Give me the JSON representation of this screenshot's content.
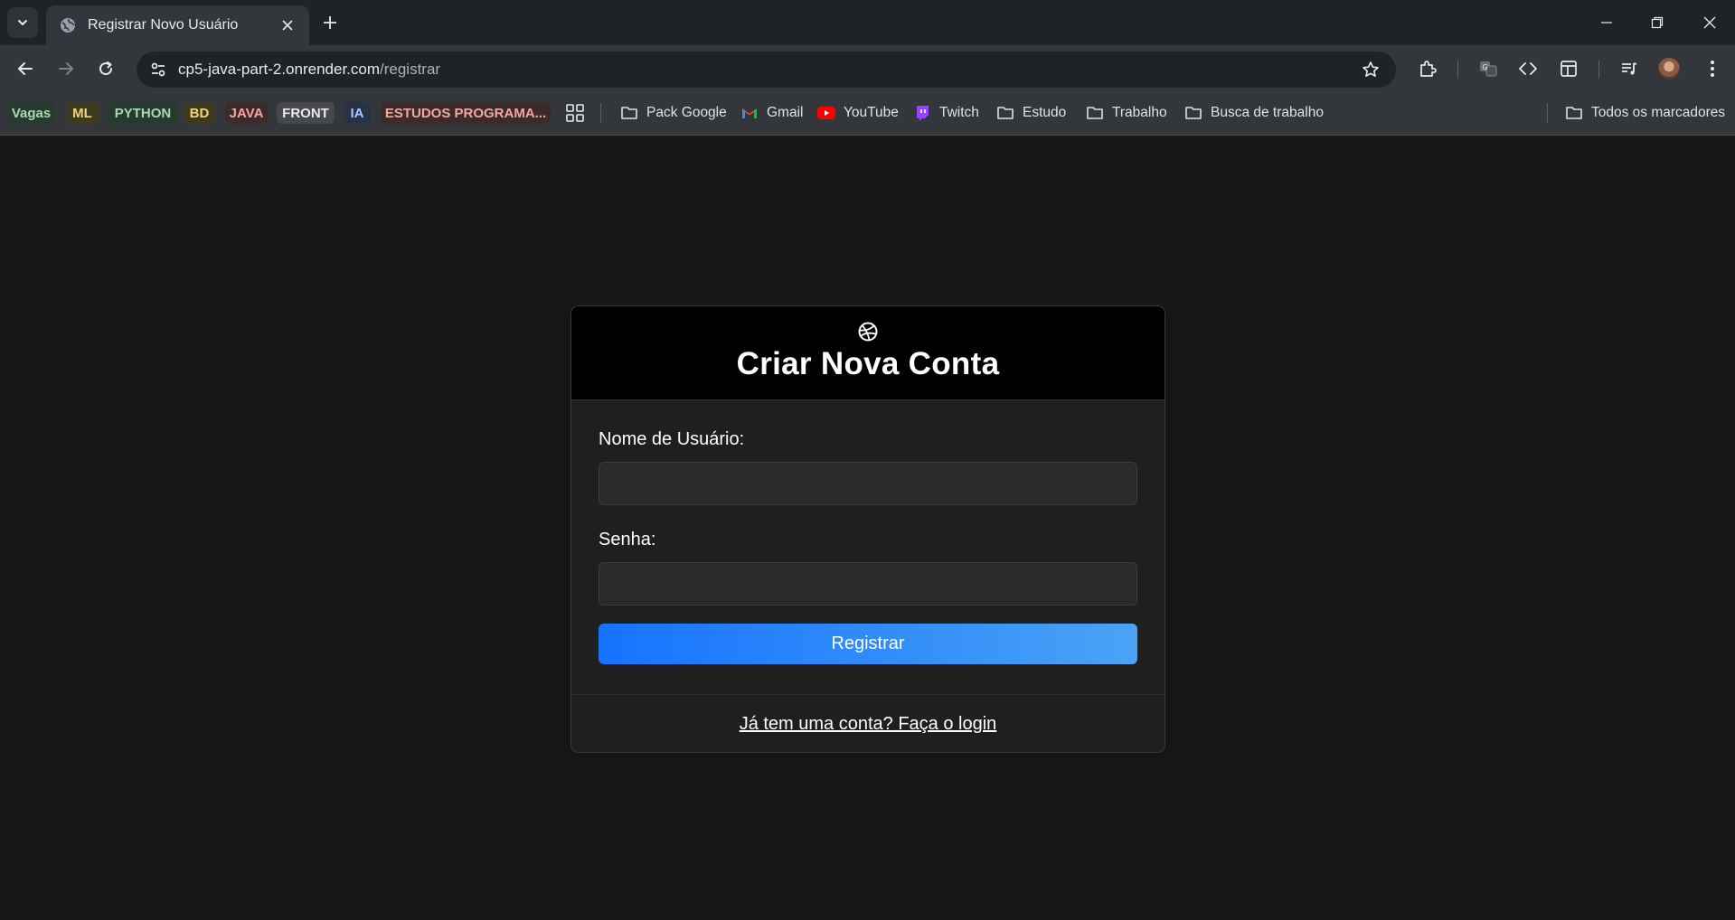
{
  "browser": {
    "tab": {
      "title": "Registrar Novo Usuário"
    },
    "address": {
      "host": "cp5-java-part-2.onrender.com",
      "path": "/registrar"
    },
    "bookmark_chips": [
      {
        "label": "Vagas",
        "bg": "#263a2e",
        "fg": "#a8dab5"
      },
      {
        "label": "ML",
        "bg": "#3e3a1e",
        "fg": "#f5d37a"
      },
      {
        "label": "PYTHON",
        "bg": "#263a2e",
        "fg": "#a8dab5"
      },
      {
        "label": "BD",
        "bg": "#3e3a1e",
        "fg": "#f5d37a"
      },
      {
        "label": "JAVA",
        "bg": "#3d2a2a",
        "fg": "#f2a8a0"
      },
      {
        "label": "FRONT",
        "bg": "#46484c",
        "fg": "#e8eaed"
      },
      {
        "label": "IA",
        "bg": "#283246",
        "fg": "#a8c7fa"
      },
      {
        "label": "ESTUDOS PROGRAMA...",
        "bg": "#3d2a2a",
        "fg": "#f2a8a0"
      }
    ],
    "bookmarks": [
      {
        "label": "Pack Google",
        "icon": "folder-icon"
      },
      {
        "label": "Gmail",
        "icon": "gmail-icon"
      },
      {
        "label": "YouTube",
        "icon": "youtube-icon"
      },
      {
        "label": "Twitch",
        "icon": "twitch-icon"
      },
      {
        "label": "Estudo",
        "icon": "folder-icon"
      },
      {
        "label": "Trabalho",
        "icon": "folder-icon"
      },
      {
        "label": "Busca de trabalho",
        "icon": "folder-icon"
      }
    ],
    "all_bookmarks_label": "Todos os marcadores"
  },
  "form": {
    "logo_icon": "dribbble-ball-icon",
    "title": "Criar Nova Conta",
    "username_label": "Nome de Usuário:",
    "username_value": "",
    "password_label": "Senha:",
    "password_value": "",
    "submit_label": "Registrar",
    "login_link": "Já tem uma conta? Faça o login"
  }
}
